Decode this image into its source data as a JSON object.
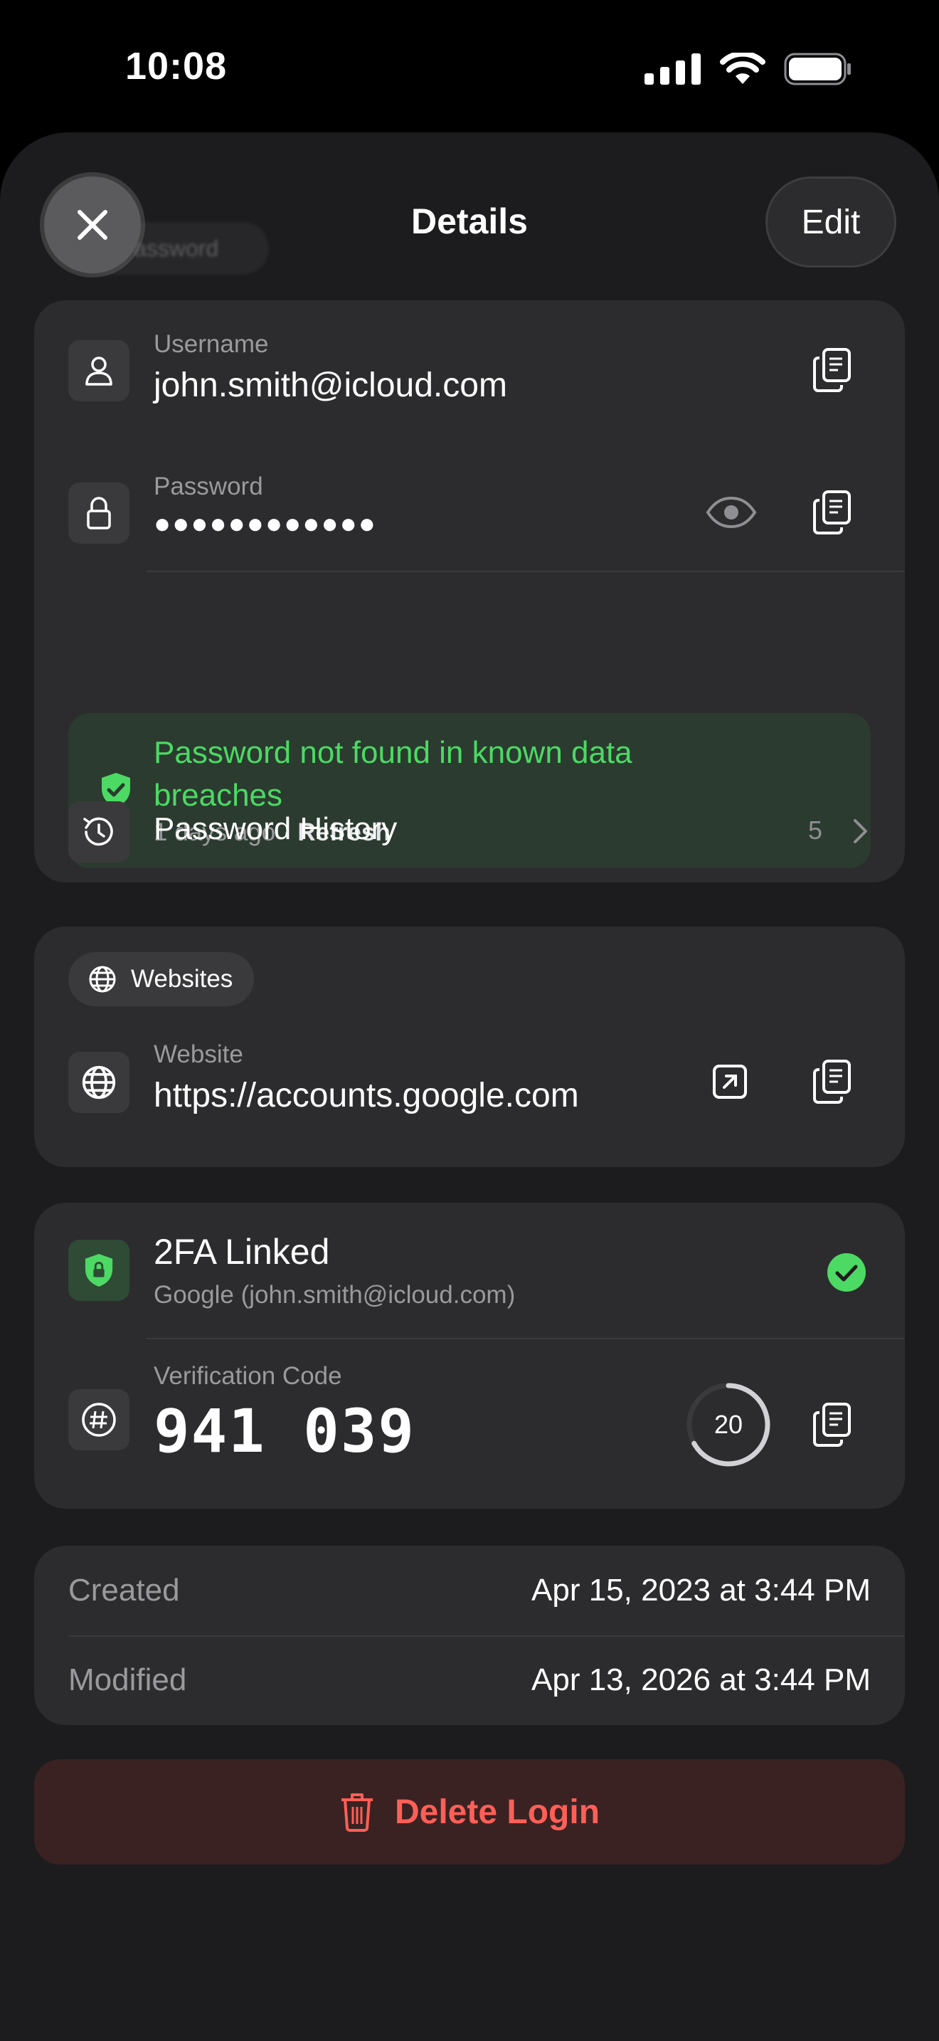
{
  "status_bar": {
    "time": "10:08"
  },
  "nav": {
    "title": "Details",
    "edit_label": "Edit",
    "ghost_label": "Password"
  },
  "credentials": {
    "username_label": "Username",
    "username_value": "john.smith@icloud.com",
    "password_label": "Password",
    "password_value": "●●●●●●●●●●●●",
    "breach_title": "Password not found in known data breaches",
    "breach_age": "1 days ago",
    "breach_dot": "·",
    "breach_refresh": "Refresh",
    "history_label": "Password History",
    "history_count": "5"
  },
  "websites": {
    "section_label": "Websites",
    "website_label": "Website",
    "website_value": "https://accounts.google.com"
  },
  "twofa": {
    "title": "2FA Linked",
    "subtitle": "Google (john.smith@icloud.com)",
    "code_label": "Verification Code",
    "code_value": "941 039",
    "timer": "20",
    "timer_fraction": 0.67
  },
  "meta": {
    "created_label": "Created",
    "created_value": "Apr 15, 2023 at 3:44 PM",
    "modified_label": "Modified",
    "modified_value": "Apr 13, 2026 at 3:44 PM"
  },
  "delete_label": "Delete Login",
  "colors": {
    "accent_green": "#4cd964",
    "danger": "#ff5f57",
    "card": "#2c2c2e",
    "sheet": "#1c1c1e"
  }
}
